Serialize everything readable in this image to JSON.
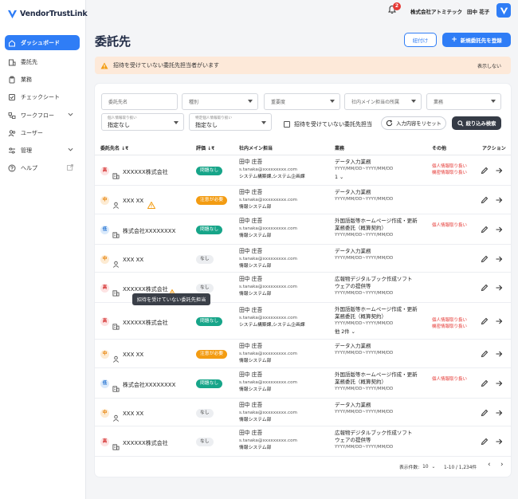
{
  "app": {
    "name": "VendorTrustLink"
  },
  "sidebar": {
    "items": [
      {
        "label": "ダッシュボード",
        "icon": "home-icon",
        "active": true
      },
      {
        "label": "委託先",
        "icon": "building-icon"
      },
      {
        "label": "業務",
        "icon": "clipboard-icon"
      },
      {
        "label": "チェックシート",
        "icon": "checkbox-icon"
      },
      {
        "label": "ワークフロー",
        "icon": "workflow-icon",
        "expandable": true
      },
      {
        "label": "ユーザー",
        "icon": "users-icon"
      },
      {
        "label": "管理",
        "icon": "sliders-icon",
        "expandable": true
      },
      {
        "label": "ヘルプ",
        "icon": "help-icon",
        "external": true
      }
    ]
  },
  "header": {
    "notification_count": "2",
    "company": "株式会社アトミテック",
    "user": "田中 花子"
  },
  "page": {
    "title": "委託先",
    "tag_button": "紐付け",
    "new_button": "新規委託先を登録"
  },
  "alert": {
    "text": "招待を受けていない委託先担当者がいます",
    "hide_label": "表示しない"
  },
  "filters": {
    "vendor_name_placeholder": "委託先名",
    "type_placeholder": "種別",
    "importance_placeholder": "重要度",
    "dept_placeholder": "社内メイン担当の所属",
    "business_placeholder": "業務",
    "personal_info_label": "個人情報取り扱い",
    "personal_info_value": "指定なし",
    "specific_personal_label": "特定個人情報取り扱い",
    "specific_personal_value": "指定なし",
    "uninvited_checkbox": "招待を受けていない委託先担当",
    "reset_label": "入力内容をリセット",
    "search_label": "絞り込み検索"
  },
  "table": {
    "headers": {
      "vendor": "委託先名",
      "eval": "評価",
      "staff": "社内メイン担当",
      "business": "業務",
      "other": "その他",
      "action": "アクション"
    },
    "rows": [
      {
        "priority": "高",
        "level": "high",
        "type": "company",
        "name": "XXXXXX株式会社",
        "warn": false,
        "eval": "問題なし",
        "eval_type": "ok",
        "staff_name": "田中 庄吾",
        "staff_email": "s.tanaka@xxxxxxxxx.com",
        "staff_dept": "システム構築課,システム企画課",
        "biz": [
          "データ入力業務"
        ],
        "date": "YYYY/MM/DD~YYYY/MM/DD",
        "more": "1",
        "other": [
          "個人情報取り扱い",
          "機密情報取り扱い"
        ]
      },
      {
        "priority": "中",
        "level": "mid",
        "type": "person",
        "name": "XXX XX",
        "warn": true,
        "eval": "注意が必要",
        "eval_type": "caution",
        "staff_name": "田中 庄吾",
        "staff_email": "s.tanaka@xxxxxxxxx.com",
        "staff_dept": "情報システム部",
        "biz": [
          "データ入力業務"
        ],
        "date": "YYYY/MM/DD~YYYY/MM/DD",
        "more": "",
        "other": []
      },
      {
        "priority": "低",
        "level": "low",
        "type": "company",
        "name": "株式会社XXXXXXXX",
        "warn": false,
        "eval": "問題なし",
        "eval_type": "ok",
        "staff_name": "田中 庄吾",
        "staff_email": "s.tanaka@xxxxxxxxx.com",
        "staff_dept": "情報システム部",
        "biz": [
          "外国語版等ホームページ作成・更新",
          "業務委託（概算契約）"
        ],
        "date": "YYYY/MM/DD~YYYY/MM/DD",
        "more": "",
        "other": [
          "個人情報取り扱い"
        ]
      },
      {
        "priority": "中",
        "level": "mid",
        "type": "person",
        "name": "XXX XX",
        "warn": false,
        "eval": "なし",
        "eval_type": "none",
        "staff_name": "田中 庄吾",
        "staff_email": "s.tanaka@xxxxxxxxx.com",
        "staff_dept": "情報システム部",
        "biz": [
          "データ入力業務"
        ],
        "date": "YYYY/MM/DD~YYYY/MM/DD",
        "more": "",
        "other": []
      },
      {
        "priority": "高",
        "level": "high",
        "type": "company",
        "name": "XXXXXX株式会社",
        "warn": true,
        "eval": "なし",
        "eval_type": "none",
        "staff_name": "田中 庄吾",
        "staff_email": "s.tanaka@xxxxxxxxx.com",
        "staff_dept": "情報システム部",
        "biz": [
          "広報物デジタルブック作成ソフト",
          "ウェアの提供等"
        ],
        "date": "YYYY/MM/DD~YYYY/MM/DD",
        "more": "",
        "other": []
      },
      {
        "priority": "高",
        "level": "high",
        "type": "company",
        "name": "XXXXXX株式会社",
        "warn": false,
        "eval": "問題なし",
        "eval_type": "ok",
        "staff_name": "田中 庄吾",
        "staff_email": "s.tanaka@xxxxxxxxx.com",
        "staff_dept": "システム構築課,システム企画課",
        "biz": [
          "外国語版等ホームページ作成・更新",
          "業務委託（概算契約）"
        ],
        "date": "YYYY/MM/DD~YYYY/MM/DD",
        "more": "他 2件",
        "other": [
          "個人情報取り扱い",
          "機密情報取り扱い"
        ]
      },
      {
        "priority": "中",
        "level": "mid",
        "type": "person",
        "name": "XXX XX",
        "warn": false,
        "eval": "注意が必要",
        "eval_type": "caution",
        "staff_name": "田中 庄吾",
        "staff_email": "s.tanaka@xxxxxxxxx.com",
        "staff_dept": "情報システム部",
        "biz": [
          "データ入力業務"
        ],
        "date": "YYYY/MM/DD~YYYY/MM/DD",
        "more": "",
        "other": []
      },
      {
        "priority": "低",
        "level": "low",
        "type": "company",
        "name": "株式会社XXXXXXXX",
        "warn": false,
        "eval": "問題なし",
        "eval_type": "ok",
        "staff_name": "田中 庄吾",
        "staff_email": "s.tanaka@xxxxxxxxx.com",
        "staff_dept": "情報システム部",
        "biz": [
          "外国語版等ホームページ作成・更新",
          "業務委託（概算契約）"
        ],
        "date": "YYYY/MM/DD~YYYY/MM/DD",
        "more": "",
        "other": [
          "個人情報取り扱い"
        ]
      },
      {
        "priority": "中",
        "level": "mid",
        "type": "person",
        "name": "XXX XX",
        "warn": false,
        "eval": "なし",
        "eval_type": "none",
        "staff_name": "田中 庄吾",
        "staff_email": "s.tanaka@xxxxxxxxx.com",
        "staff_dept": "情報システム部",
        "biz": [
          "データ入力業務"
        ],
        "date": "YYYY/MM/DD~YYYY/MM/DD",
        "more": "",
        "other": []
      },
      {
        "priority": "高",
        "level": "high",
        "type": "company",
        "name": "XXXXXX株式会社",
        "warn": false,
        "eval": "なし",
        "eval_type": "none",
        "staff_name": "田中 庄吾",
        "staff_email": "s.tanaka@xxxxxxxxx.com",
        "staff_dept": "情報システム部",
        "biz": [
          "広報物デジタルブック作成ソフト",
          "ウェアの提供等"
        ],
        "date": "YYYY/MM/DD~YYYY/MM/DD",
        "more": "",
        "other": []
      }
    ]
  },
  "tooltip": "招待を受けていない委託先担当",
  "pagination": {
    "per_page_label": "表示件数:",
    "per_page": "10",
    "range": "1-10 / 1,234件"
  }
}
